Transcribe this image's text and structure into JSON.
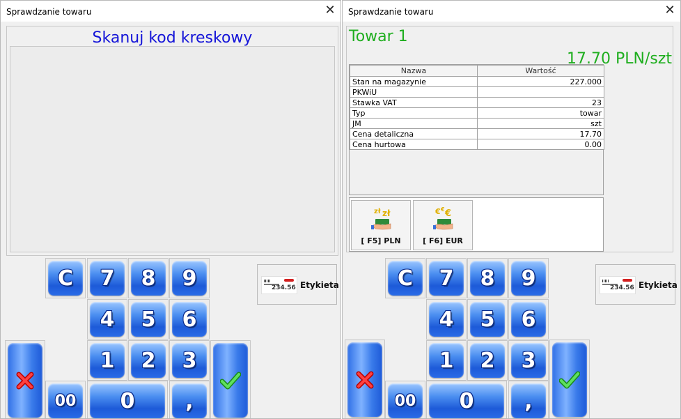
{
  "left_window": {
    "title": "Sprawdzanie towaru",
    "close_glyph": "✕",
    "scan_prompt": "Skanuj kod kreskowy"
  },
  "right_window": {
    "title": "Sprawdzanie towaru",
    "close_glyph": "✕",
    "product_name": "Towar 1",
    "product_price": "17.70 PLN/szt",
    "table": {
      "headers": [
        "Nazwa",
        "Wartość"
      ],
      "rows": [
        {
          "name": "Stan na magazynie",
          "value": "227.000"
        },
        {
          "name": "PKWiU",
          "value": ""
        },
        {
          "name": "Stawka VAT",
          "value": "23"
        },
        {
          "name": "Typ",
          "value": "towar"
        },
        {
          "name": "JM",
          "value": "szt"
        },
        {
          "name": "Cena detaliczna",
          "value": "17.70"
        },
        {
          "name": "Cena hurtowa",
          "value": "0.00"
        }
      ]
    },
    "currency_buttons": [
      {
        "label": "[ F5] PLN",
        "icon": "pln-money-hand-icon"
      },
      {
        "label": "[ F6] EUR",
        "icon": "eur-money-hand-icon"
      }
    ]
  },
  "keypad": {
    "clear": "C",
    "k7": "7",
    "k8": "8",
    "k9": "9",
    "k4": "4",
    "k5": "5",
    "k6": "6",
    "k1": "1",
    "k2": "2",
    "k3": "3",
    "k00": "00",
    "k0": "0",
    "comma": ",",
    "cancel_icon": "red-x-icon",
    "confirm_icon": "green-check-icon"
  },
  "label_button": {
    "text": "Etykieta",
    "tag_number": "234.56"
  },
  "colors": {
    "scan_prompt": "#1414d8",
    "product_text": "#1fae1f",
    "key_blue": "#2a6be6"
  }
}
